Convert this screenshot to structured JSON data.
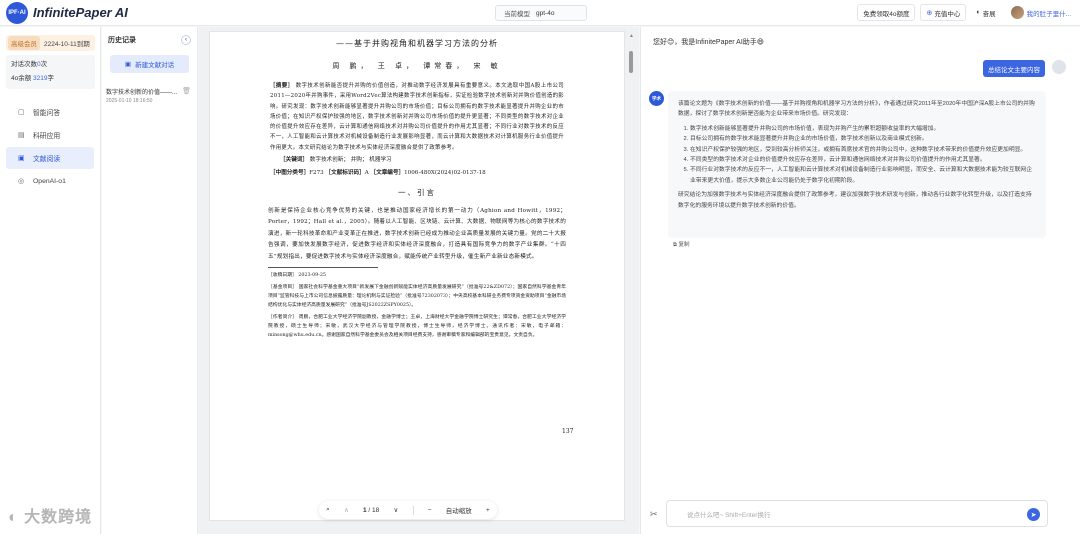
{
  "header": {
    "logo_mark": "IPF·AI",
    "app_name": "InfinitePaper AI",
    "model_label": "当前模型",
    "model_value": "gpt-4o",
    "free_btn": "免费领取4o额度",
    "recharge_btn": "充值中心",
    "brand_btn": "奋展",
    "user_name": "我的肚子里什..."
  },
  "sidebar": {
    "member_tag": "高级会员",
    "member_expire": "2224-10-11到期",
    "usage_dialog_label": "对话次数",
    "usage_dialog_value": "0",
    "usage_dialog_unit": "次",
    "usage_4o_label": "4o余额",
    "usage_4o_value": "3219",
    "usage_4o_unit": "字",
    "nav": [
      {
        "label": "智能问答",
        "icon": "chat-icon"
      },
      {
        "label": "科研应用",
        "icon": "document-icon"
      },
      {
        "label": "文献阅读",
        "icon": "book-icon"
      },
      {
        "label": "OpenAI-o1",
        "icon": "o1-icon"
      }
    ]
  },
  "history": {
    "title": "历史记录",
    "new_btn": "新建文献对话",
    "items": [
      {
        "title": "数字技术创新的价值——...",
        "time": "2025-01-10 18:16:50"
      }
    ]
  },
  "pdf": {
    "subtitle": "——基于并购视角和机器学习方法的分析",
    "authors": "周 鹏， 王 卓， 谭常春， 宋 敏",
    "abstract_label": "［摘要］",
    "abstract": "数字技术创新能否提升并购的价值创造，对推动数字经济发展具有重要意义。本文选取中国A股上市公司2011—2020年并购事件，采用Word2Vec算法构建数字技术创新指标，实证检验数字技术创新对并购价值创造的影响。研究发现：数字技术创新能够显著提升并购公司的市场价值；目标公司拥有的数字技术能显著提升并购企业的市场价值；在知识产权保护较强的地区，数字技术创新对并购公司市场价值的提升更显著；不同类型的数字技术对企业的价值提升效应存在差异，云计算和通信网络技术对并购公司价值提升的作用尤其显著；不同行业对数字技术的反应不一，人工智能和云计算技术对机械设备制造行业发展影响显著，而云计算和大数据技术对计算机服务行业价值提升作用更大。本文研究结论为数字技术与实体经济深度融合提供了政策参考。",
    "keywords_label": "［关键词］",
    "keywords": "数字技术创新； 并购； 机器学习",
    "class_label": "［中图分类号］",
    "class_value": "F273",
    "doc_code_label": "［文献标识码］",
    "doc_code_value": "A",
    "article_no_label": "［文章编号］",
    "article_no_value": "1006-480X(2024)02-0137-18",
    "section_title": "一、引言",
    "body": "创新是保持企业核心竞争优势的关键，也是推动国家经济增长的第一动力（Aghion and Howitt，1992；Porter，1992；Hall et al.，2005）。随着以人工智能、区块链、云计算、大数据、物联网等为核心的数字技术的演进，新一轮科技革命和产业变革正在推进，数字技术创新已经成为推动企业高质量发展的关键力量。党的二十大报告强调，要加快发展数字经济，促进数字经济和实体经济深度融合，打造具有国际竞争力的数字产业集群。“十四五”规划指出，要促进数字技术与实体经济深度融合，赋能传统产业转型升级，催生新产业新业态新模式。",
    "footnote_received": "［收稿日期］ 2023-09-25",
    "footnote_fund": "［基金项目］ 国家社会科学基金重大项目“新发展下金融创新赋能实体经济高质量发展研究”（批准号22&ZD072）；国家自然科学基金青年项目“监管科技与上市公司信息披露质量：理论机制与实证检验”（批准号72302073）；中央高校基本科研业务费专项资金资助项目“金融市场结构优化与实体经济高质量发展研究”（批准号JS2022ZSPY0025）。",
    "footnote_author": "［作者简介］ 周鹏，合肥工业大学经济学院副教授，金融学博士；王卓，上海财经大学金融学院博士研究生；谭常春，合肥工业大学经济学院教授，硕士生导师；宋敏，武汉大学经济与管理学院教授，博士生导师，经济学博士。通讯作者：宋敏，电子邮箱：minsong@whu.edu.cn。感谢国家自然科学基金委员会及相关项目经费支持，感谢审稿专家和编辑部的宝贵意见，文责自负。",
    "page_number": "137",
    "toolbar": {
      "search_icon": "search-icon",
      "page_current": "1",
      "page_total": "18",
      "zoom_label": "自动缩放"
    }
  },
  "chat": {
    "greeting": "您好😊，我是InfinitePaper AI助手😄",
    "user_message": "总结论文主要内容",
    "bot_avatar": "学术",
    "bot_intro": "该篇论文题为《数字技术创新的价值——基于并购视角和机器学习方法的分析》，作者通过研究2011年至2020年中国沪深A股上市公司的并购数据，探讨了数字技术创新是否能为企业带来市场价值。研究发现：",
    "bot_points": [
      "数字技术创新能够显著提升并购公司的市场价值，表现为并购产生的累积超额收益率的大幅增加。",
      "目标公司拥有的数字技术能显著提升并购企业的市场价值，数字技术创新以及商业模式创新。",
      "在知识产权保护较强的地区，受到较高分析师关注，或拥有首席技术官的并购公司中，这种数字技术带来的价值提升效应更加明显。",
      "不同类型的数字技术对企业的价值提升效应存在差异，云计算和通信网络技术对并购公司价值提升的作用尤其显著。",
      "不同行业对数字技术的反应不一，人工智能和云计算技术对机械设备制造行业影响明显，而安全、云计算和大数据技术能为较互联网企业带来更大价值，提示大多数企业公司能仍处于数字化初期阶段。"
    ],
    "bot_conclusion": "研究结论为加强数字技术与实体经济深度融合提供了政策参考，建议加强数字技术研发与创新，推动各行业数字化转型升级，以及打造支持数字化的服务环境以提升数字技术创新的价值。",
    "copy_label": "复制",
    "input_placeholder": "说点什么吧~ Shift+Enter换行",
    "watermark": "◐ 大数跨境"
  }
}
